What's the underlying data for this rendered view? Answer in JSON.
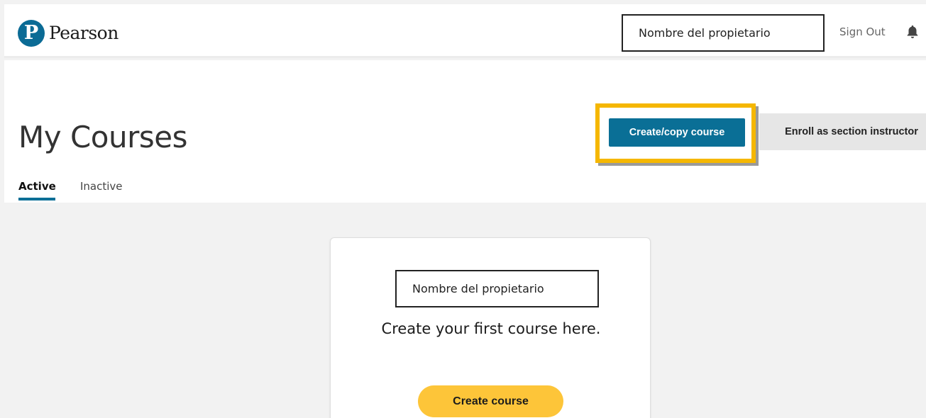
{
  "header": {
    "logo_letter": "P",
    "brand": "Pearson",
    "owner_name": "Nombre del propietario",
    "sign_out": "Sign Out",
    "bell_icon": "bell-icon"
  },
  "page": {
    "title": "My Courses",
    "create_copy_label": "Create/copy course",
    "enroll_label": "Enroll as section instructor",
    "highlight_color": "#f5b701"
  },
  "tabs": [
    {
      "label": "Active",
      "selected": true
    },
    {
      "label": "Inactive",
      "selected": false
    }
  ],
  "card": {
    "owner_name": "Nombre del propietario",
    "message": "Create your first course here.",
    "button_label": "Create course"
  },
  "colors": {
    "brand_blue": "#0a6f96",
    "cta_yellow": "#fdc539"
  }
}
